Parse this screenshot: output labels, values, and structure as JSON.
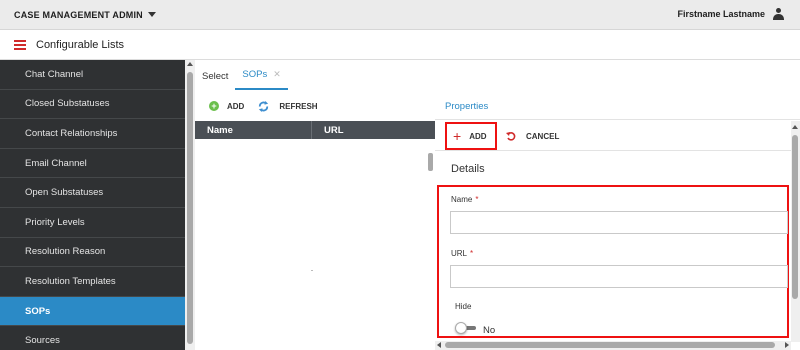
{
  "header": {
    "app_title": "CASE MANAGEMENT ADMIN",
    "user_name": "Firstname Lastname"
  },
  "subheader": {
    "page_title": "Configurable Lists"
  },
  "sidebar": {
    "items": [
      {
        "label": "Chat Channel"
      },
      {
        "label": "Closed Substatuses"
      },
      {
        "label": "Contact Relationships"
      },
      {
        "label": "Email Channel"
      },
      {
        "label": "Open Substatuses"
      },
      {
        "label": "Priority Levels"
      },
      {
        "label": "Resolution Reason"
      },
      {
        "label": "Resolution Templates"
      },
      {
        "label": "SOPs"
      },
      {
        "label": "Sources"
      }
    ],
    "active": "SOPs"
  },
  "tabs": [
    {
      "label": "Select"
    },
    {
      "label": "SOPs"
    }
  ],
  "list_toolbar": {
    "add_label": "ADD",
    "refresh_label": "REFRESH"
  },
  "grid": {
    "columns": [
      "Name",
      "URL"
    ]
  },
  "properties": {
    "tab_label": "Properties",
    "add_label": "ADD",
    "cancel_label": "CANCEL",
    "details_title": "Details",
    "name_label": "Name",
    "url_label": "URL",
    "required_marker": "*",
    "hide_label": "Hide",
    "hide_value": "No"
  },
  "colors": {
    "accent": "#2b8ac6",
    "highlight_border": "#e11111",
    "sidebar_bg": "#2f3133",
    "grid_header": "#4a4f55"
  },
  "icons": [
    "caret-down-icon",
    "user-icon",
    "menu-icon",
    "add-circle-icon",
    "refresh-icon",
    "plus-icon",
    "undo-icon",
    "close-icon"
  ]
}
